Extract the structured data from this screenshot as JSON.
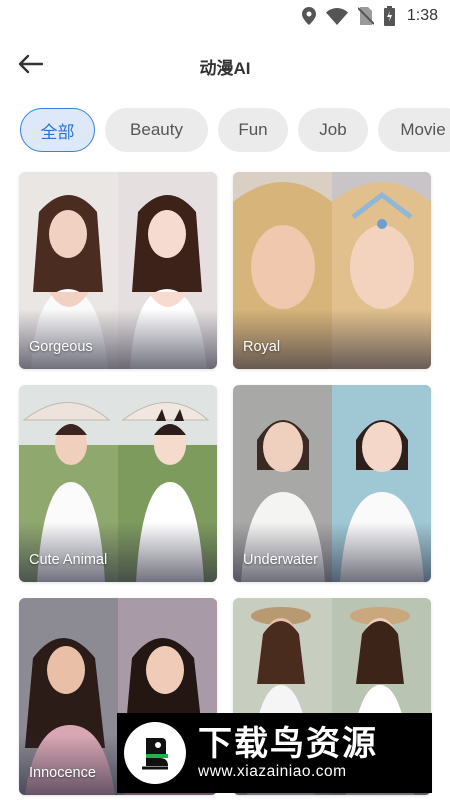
{
  "status_bar": {
    "time": "1:38",
    "icons": [
      "location-icon",
      "wifi-icon",
      "no-sim-icon",
      "battery-charging-icon"
    ]
  },
  "header": {
    "title": "动漫AI",
    "back_icon": "arrow-left-icon"
  },
  "categories": [
    "全部",
    "Beauty",
    "Fun",
    "Job",
    "Movie"
  ],
  "selected_category": "全部",
  "cards": [
    {
      "label": "Gorgeous"
    },
    {
      "label": "Royal"
    },
    {
      "label": "Cute Animal"
    },
    {
      "label": "Underwater"
    },
    {
      "label": "Innocence"
    },
    {
      "label": ""
    }
  ],
  "watermark": {
    "text": "下载鸟资源",
    "url": "www.xiazainiao.com"
  },
  "colors": {
    "accent": "#2a72d6",
    "chip_bg": "#ebebeb",
    "chip_active_bg": "#dde8f8"
  }
}
